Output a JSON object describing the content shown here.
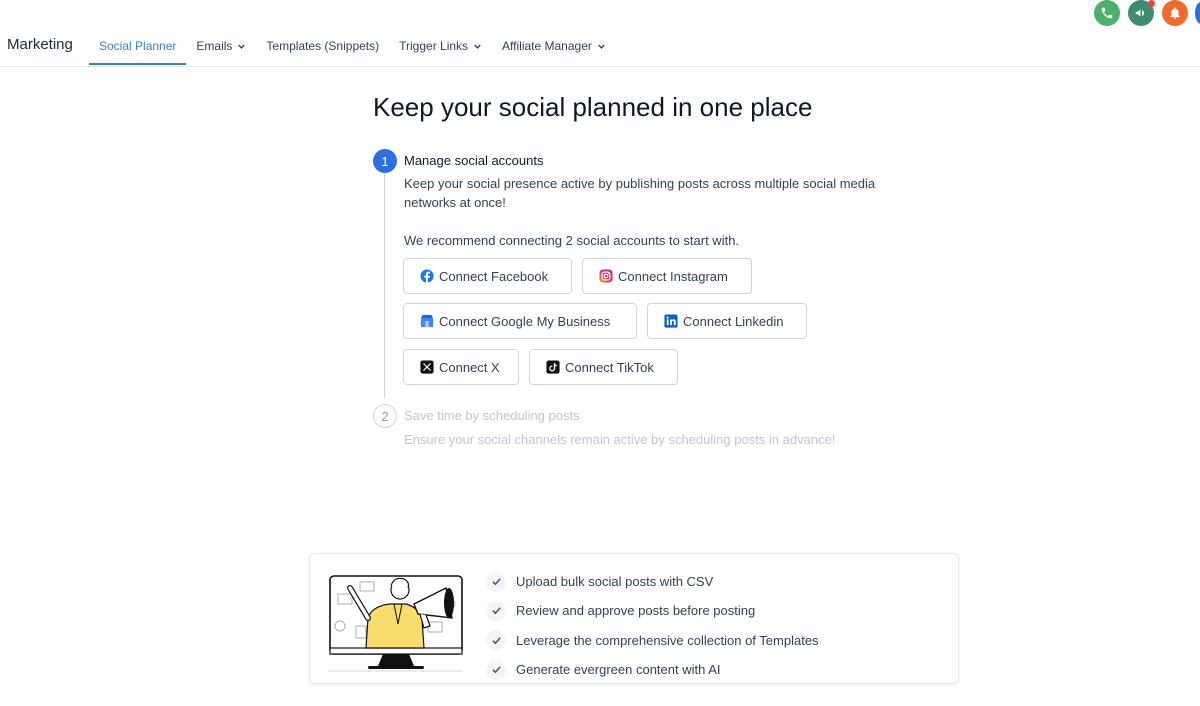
{
  "app": {
    "section_title": "Marketing"
  },
  "nav": {
    "items": [
      {
        "label": "Social Planner",
        "active": true,
        "has_dropdown": false
      },
      {
        "label": "Emails",
        "active": false,
        "has_dropdown": true
      },
      {
        "label": "Templates (Snippets)",
        "active": false,
        "has_dropdown": false
      },
      {
        "label": "Trigger Links",
        "active": false,
        "has_dropdown": true
      },
      {
        "label": "Affiliate Manager",
        "active": false,
        "has_dropdown": true
      }
    ]
  },
  "header_actions": [
    {
      "icon": "phone-icon",
      "color": "#4caf6a"
    },
    {
      "icon": "megaphone-icon",
      "color": "#3f8b6d",
      "notification": true
    },
    {
      "icon": "bell-icon",
      "color": "#f26b2d"
    }
  ],
  "main": {
    "title": "Keep your social planned in one place",
    "steps": [
      {
        "number": "1",
        "title": "Manage social accounts",
        "description": "Keep your social presence active by publishing posts across multiple social media networks at once!",
        "recommendation": "We recommend connecting 2 social accounts to start with.",
        "state": "active"
      },
      {
        "number": "2",
        "title": "Save time by scheduling posts",
        "description": "Ensure your social channels remain active by scheduling posts in advance!",
        "state": "inactive"
      }
    ],
    "connect_buttons": [
      {
        "label": "Connect Facebook",
        "icon": "facebook-icon"
      },
      {
        "label": "Connect Instagram",
        "icon": "instagram-icon"
      },
      {
        "label": "Connect Google My Business",
        "icon": "google-my-business-icon"
      },
      {
        "label": "Connect Linkedin",
        "icon": "linkedin-icon"
      },
      {
        "label": "Connect X",
        "icon": "x-icon"
      },
      {
        "label": "Connect TikTok",
        "icon": "tiktok-icon"
      }
    ]
  },
  "features": {
    "illustration": "megaphone-person-illustration",
    "items": [
      "Upload bulk social posts with CSV",
      "Review and approve posts before posting",
      "Leverage the comprehensive collection of Templates",
      "Generate evergreen content with AI"
    ]
  },
  "colors": {
    "accent": "#2f6fe0",
    "nav_active": "#3b82c4"
  }
}
